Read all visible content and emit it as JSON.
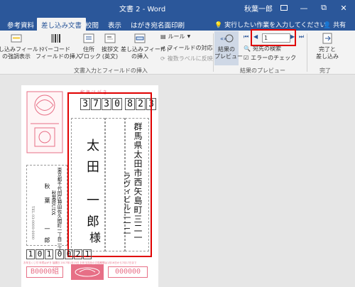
{
  "window": {
    "title": "文書 2 - Word",
    "user": "秋葉一郎",
    "minimize": "—",
    "restore": "⧉",
    "close": "✕"
  },
  "tabs": [
    "参考資料",
    "差し込み文書",
    "校閲",
    "表示",
    "はがき宛名面印刷"
  ],
  "active_tab": "差し込み文書",
  "tellme": "実行したい作業を入力してください",
  "share": "共有",
  "ribbon": {
    "highlight_merge_fields": "し込みフィールド\nの強調表示",
    "barcode_field": "バーコード\nフィールドの挿入",
    "address_block": "住所\nブロック",
    "greeting_line": "挨拶文\n(英文)",
    "insert_merge_field": "差し込みフィールド\nの挿入",
    "rules": "ルール",
    "match_fields": "フィールドの対応",
    "update_labels": "複数ラベルに反映",
    "group_write_insert": "文書入力とフィールドの挿入",
    "preview_results": "結果の\nプレビュー",
    "find_recipient": "宛先の検索",
    "check_errors": "エラーのチェック",
    "record_number": "1",
    "group_preview": "結果のプレビュー",
    "finish_merge": "完了と\n差し込み",
    "group_finish": "完了"
  },
  "postcard": {
    "postal_label": "郵 便 は が き",
    "zip_digits": [
      "3",
      "7",
      "3",
      "0",
      "8",
      "2",
      "3"
    ],
    "recipient_address": "群馬県太田市西矢島町三二一",
    "recipient_building": "ラヴィビル二一二",
    "recipient_name_family": "太田",
    "recipient_name_given": "一郎",
    "honorific": "様",
    "sender_address_1": "東京都千代田区神田佐久間町一丁目一丁",
    "sender_address_2": "秋葉原UDX",
    "sender_name_family": "秋",
    "sender_name_given": "葉",
    "sender_name_3": "一",
    "sender_name_4": "郎",
    "sender_tel": "TEL 03-0000-0000",
    "sender_zip_digits": [
      "1",
      "0",
      "1",
      "0",
      "0",
      "2",
      "1"
    ],
    "lottery_group": "B0000組",
    "lottery_number": "000000",
    "footer_text": "お年玉くじ付 年賀はがき 抽選日 2017年1月15日 お年玉賞品の交換期間は1月16日から7月17日まで"
  }
}
